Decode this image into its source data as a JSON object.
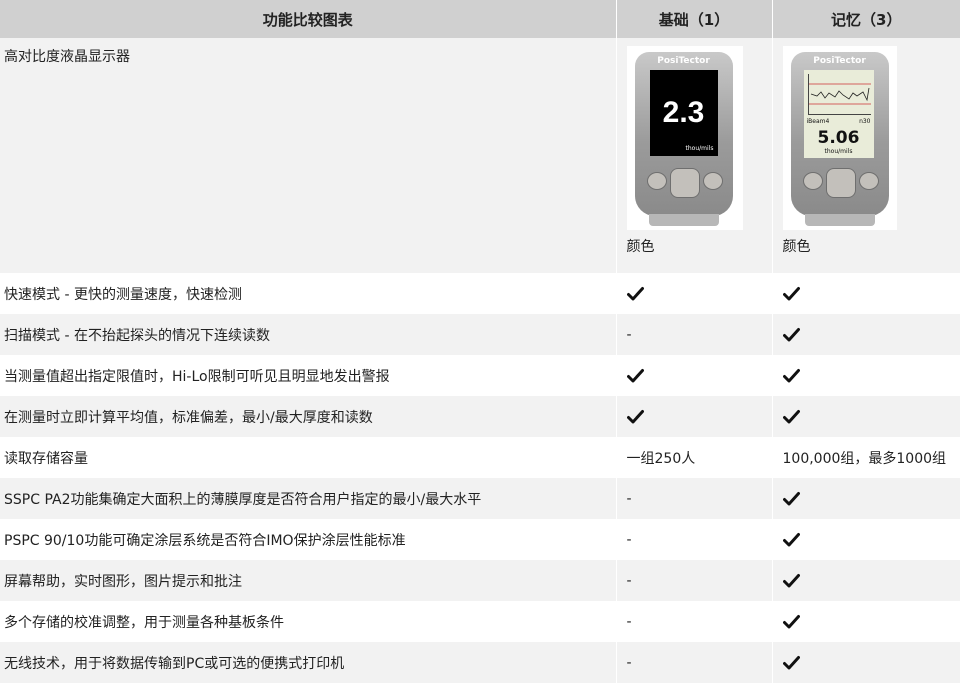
{
  "headers": [
    "功能比较图表",
    "基础（1）",
    "记忆（3）"
  ],
  "devices": {
    "brand": "PosiTector",
    "basic_reading": "2.3",
    "basic_unit": "thou/mils",
    "memory_reading": "5.06",
    "memory_batch": "iBeam4",
    "memory_count": "n30",
    "memory_unit": "thou/mils"
  },
  "image_row": {
    "label": "高对比度液晶显示器",
    "basic_caption": "颜色",
    "memory_caption": "颜色"
  },
  "rows": [
    {
      "label": "快速模式 - 更快的测量速度，快速检测",
      "basic": "check",
      "memory": "check"
    },
    {
      "label": "扫描模式 - 在不抬起探头的情况下连续读数",
      "basic": "-",
      "memory": "check"
    },
    {
      "label": "当测量值超出指定限值时，Hi-Lo限制可听见且明显地发出警报",
      "basic": "check",
      "memory": "check"
    },
    {
      "label": "在测量时立即计算平均值，标准偏差，最小/最大厚度和读数",
      "basic": "check",
      "memory": "check"
    },
    {
      "label": "读取存储容量",
      "basic": "一组250人",
      "memory": "100,000组，最多1000组"
    },
    {
      "label": "SSPC PA2功能集确定大面积上的薄膜厚度是否符合用户指定的最小/最大水平",
      "basic": "-",
      "memory": "check"
    },
    {
      "label": "PSPC 90/10功能可确定涂层系统是否符合IMO保护涂层性能标准",
      "basic": "-",
      "memory": "check"
    },
    {
      "label": "屏幕帮助，实时图形，图片提示和批注",
      "basic": "-",
      "memory": "check"
    },
    {
      "label": "多个存储的校准调整，用于测量各种基板条件",
      "basic": "-",
      "memory": "check"
    },
    {
      "label": "无线技术，用于将数据传输到PC或可选的便携式打印机",
      "basic": "-",
      "memory": "check"
    }
  ],
  "icons": {
    "check": "check-mark-icon"
  }
}
